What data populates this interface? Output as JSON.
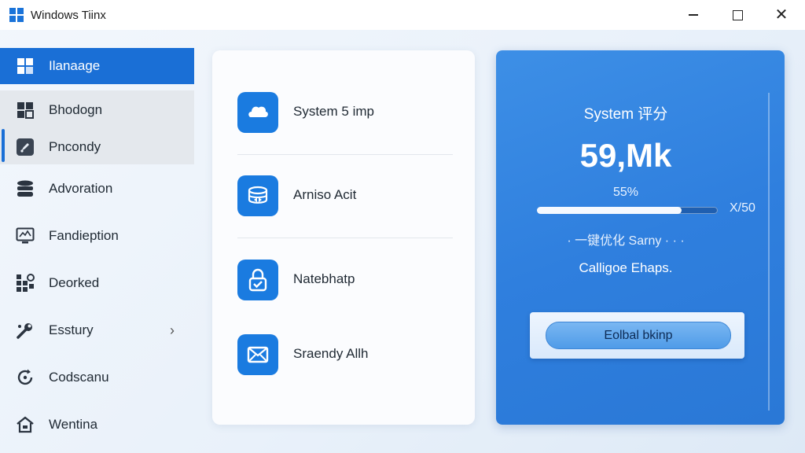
{
  "window": {
    "title": "Windows Tiinx",
    "controls": {
      "minimize": "minimize-icon",
      "maximize": "maximize-icon",
      "close": "close-icon"
    }
  },
  "sidebar": {
    "items": [
      {
        "label": "Ilanaage",
        "icon": "grid-icon",
        "active": true
      },
      {
        "label": "Bhodogn",
        "icon": "blocks-icon"
      },
      {
        "label": "Pncondy",
        "icon": "rocket-icon"
      },
      {
        "label": "Advoration",
        "icon": "database-icon"
      },
      {
        "label": "Fandieption",
        "icon": "monitor-chart-icon"
      },
      {
        "label": "Deorked",
        "icon": "apps-icon"
      },
      {
        "label": "Esstury",
        "icon": "tools-icon",
        "chevron": "chevron-right-icon"
      },
      {
        "label": "Codscanu",
        "icon": "refresh-icon"
      },
      {
        "label": "Wentina",
        "icon": "home-icon"
      }
    ]
  },
  "features": {
    "items": [
      {
        "label": "System 5 imp",
        "icon": "cloud-icon"
      },
      {
        "label": "Arniso Acit",
        "icon": "database-sync-icon"
      },
      {
        "label": "Natebhatp",
        "icon": "lock-check-icon"
      },
      {
        "label": "Sraendy Allh",
        "icon": "mail-icon"
      }
    ]
  },
  "score_panel": {
    "title": "System 评分",
    "score": "59,Mk",
    "percent": "55%",
    "progress": 0.8,
    "ratio": "X/50",
    "optimize_hint": "· 一键优化 Sarny · · ·",
    "status": "Calligoe Ehaps.",
    "button_label": "Eolbal bkinp"
  },
  "colors": {
    "accent": "#1a6fd6",
    "panel": "#2f7fde",
    "icon_tile": "#1a7be0"
  }
}
